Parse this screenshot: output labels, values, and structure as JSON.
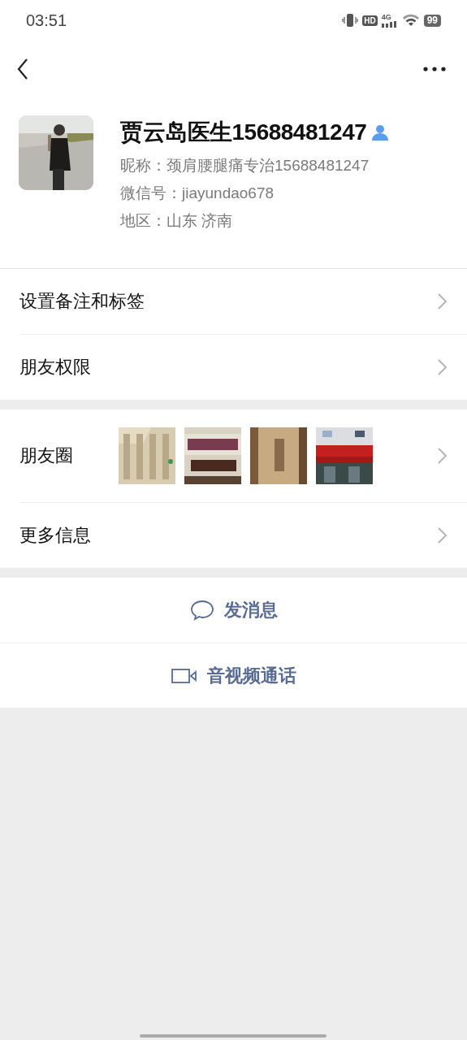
{
  "status_bar": {
    "time": "03:51",
    "hd": "HD",
    "network": "4G",
    "battery": "99"
  },
  "profile": {
    "name": "贾云岛医生15688481247",
    "nickname": "昵称：颈肩腰腿痛专治15688481247",
    "wechat_id": "微信号：jiayundao678",
    "region_label": "地区：",
    "region": "山东  济南"
  },
  "sections": [
    [
      {
        "kind": "link",
        "label": "设置备注和标签"
      },
      {
        "kind": "link",
        "label": "朋友权限"
      }
    ],
    [
      {
        "kind": "moments",
        "label": "朋友圈"
      },
      {
        "kind": "link",
        "label": "更多信息"
      }
    ]
  ],
  "actions": [
    {
      "kind": "message",
      "label": "发消息"
    },
    {
      "kind": "video",
      "label": "音视频通话"
    }
  ]
}
